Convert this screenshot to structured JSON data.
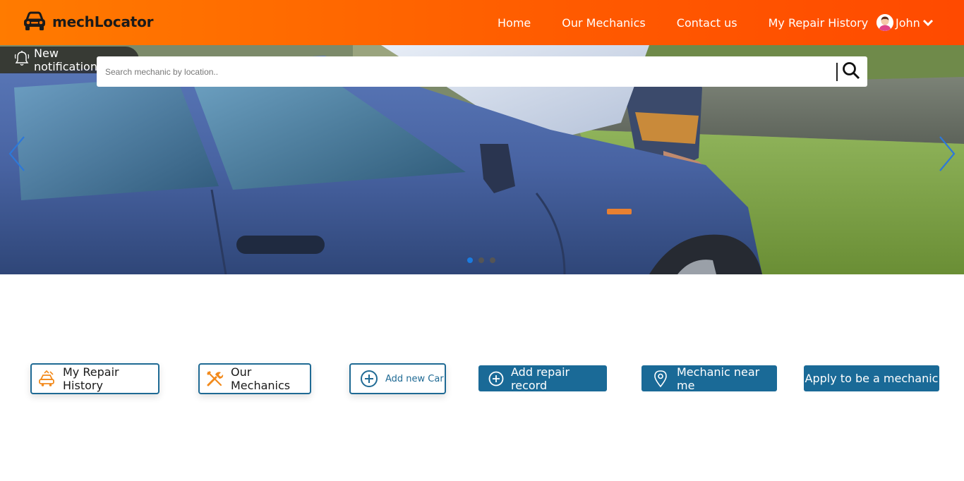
{
  "brand": {
    "name": "mechLocator"
  },
  "nav": {
    "links": [
      "Home",
      "Our Mechanics",
      "Contact us",
      "My Repair History"
    ],
    "user_name": "John"
  },
  "notification": {
    "label": "New notification(s)"
  },
  "search": {
    "placeholder": "Search mechanic by location.."
  },
  "carousel": {
    "slide_count": 3,
    "active_index": 0
  },
  "actions": {
    "repair_history": "My Repair History",
    "our_mechanics": "Our Mechanics",
    "add_car": "Add new Car",
    "add_repair": "Add repair record",
    "near_me": "Mechanic near me",
    "apply": "Apply to be a mechanic"
  },
  "colors": {
    "header_start": "#ff7b00",
    "header_end": "#ff4a00",
    "primary_blue": "#1a6a97",
    "icon_orange": "#f28a1c"
  }
}
